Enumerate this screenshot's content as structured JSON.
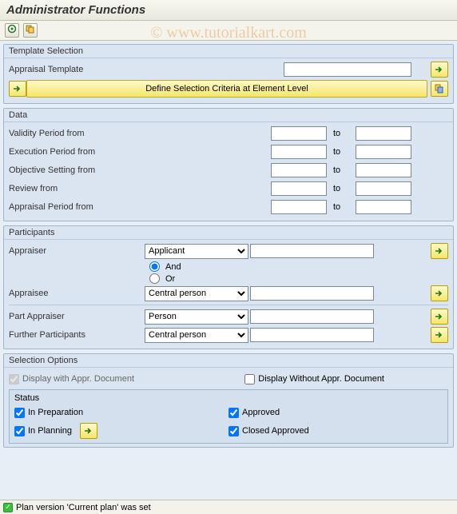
{
  "title": "Administrator Functions",
  "watermark": "© www.tutorialkart.com",
  "toolbar": {
    "execute_tip": "Execute",
    "variant_tip": "Variants"
  },
  "template_selection": {
    "title": "Template Selection",
    "appraisal_template_label": "Appraisal Template",
    "appraisal_template_value": "",
    "define_criteria_btn": "Define Selection Criteria at Element Level"
  },
  "data": {
    "title": "Data",
    "to_label": "to",
    "rows": [
      {
        "label": "Validity Period from",
        "from": "",
        "to": ""
      },
      {
        "label": "Execution Period from",
        "from": "",
        "to": ""
      },
      {
        "label": "Objective Setting from",
        "from": "",
        "to": ""
      },
      {
        "label": "Review from",
        "from": "",
        "to": ""
      },
      {
        "label": "Appraisal Period from",
        "from": "",
        "to": ""
      }
    ]
  },
  "participants": {
    "title": "Participants",
    "appraiser_label": "Appraiser",
    "appraiser_type": "Applicant",
    "appraiser_value": "",
    "and_label": "And",
    "or_label": "Or",
    "appraisee_label": "Appraisee",
    "appraisee_type": "Central person",
    "appraisee_value": "",
    "part_appraiser_label": "Part Appraiser",
    "part_appraiser_type": "Person",
    "part_appraiser_value": "",
    "further_label": "Further Participants",
    "further_type": "Central person",
    "further_value": ""
  },
  "selection_options": {
    "title": "Selection Options",
    "display_with_label": "Display with Appr. Document",
    "display_without_label": "Display Without Appr. Document",
    "status_title": "Status",
    "status": {
      "in_preparation": "In Preparation",
      "in_planning": "In Planning",
      "approved": "Approved",
      "closed_approved": "Closed Approved"
    }
  },
  "footer": {
    "message": "Plan version 'Current plan' was set"
  }
}
